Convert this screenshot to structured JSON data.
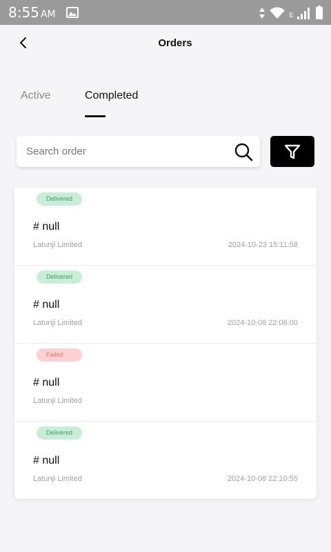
{
  "status_bar": {
    "time": "8:55",
    "ampm": "AM",
    "data_indicator": "E"
  },
  "header": {
    "title": "Orders"
  },
  "tabs": [
    {
      "label": "Active",
      "selected": false
    },
    {
      "label": "Completed",
      "selected": true
    }
  ],
  "search": {
    "placeholder": "Search order",
    "value": ""
  },
  "orders": [
    {
      "status": "Delivered",
      "number": "# null",
      "merchant": "Latunji Limited",
      "date": "2024-10-23 15:11:58"
    },
    {
      "status": "Delivered",
      "number": "# null",
      "merchant": "Latunji Limited",
      "date": "2024-10-08 22:06:00"
    },
    {
      "status": "Failed",
      "number": "# null",
      "merchant": "Latunji Limited",
      "date": ""
    },
    {
      "status": "Delivered",
      "number": "# null",
      "merchant": "Latunji Limited",
      "date": "2024-10-08 22:10:55"
    }
  ],
  "colors": {
    "delivered_badge_bg": "#c8eed8",
    "delivered_badge_text": "#3f9a67",
    "failed_badge_bg": "#ffd0d0",
    "failed_badge_text": "#e0787c",
    "filter_button_bg": "#000000"
  }
}
